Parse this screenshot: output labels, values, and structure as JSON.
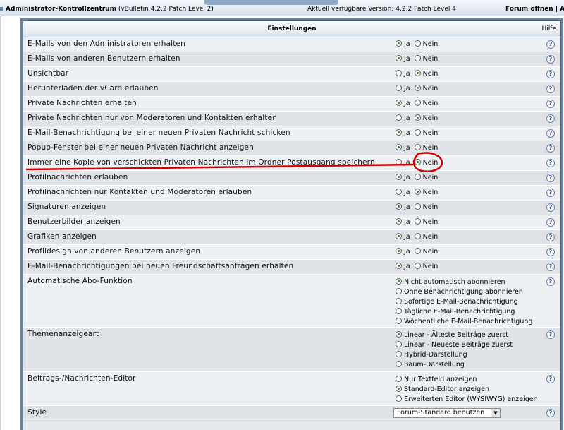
{
  "topbar": {
    "admin_title": "Administrator-Kontrollzentrum",
    "vb_version": "(vBulletin 4.2.2 Patch Level 2)",
    "available_version": "Aktuell verfügbare Version: 4.2.2 Patch Level 4",
    "forum_open": "Forum öffnen | Ab"
  },
  "panel": {
    "title": "Einstellungen",
    "help": "Hilfe"
  },
  "rows": [
    {
      "label": "E-Mails von den Administratoren erhalten",
      "yes": "Ja",
      "no": "Nein",
      "selected": "Ja"
    },
    {
      "label": "E-Mails von anderen Benutzern erhalten",
      "yes": "Ja",
      "no": "Nein",
      "selected": "Ja"
    },
    {
      "label": "Unsichtbar",
      "yes": "Ja",
      "no": "Nein",
      "selected": "Nein"
    },
    {
      "label": "Herunterladen der vCard erlauben",
      "yes": "Ja",
      "no": "Nein",
      "selected": "Nein"
    },
    {
      "label": "Private Nachrichten erhalten",
      "yes": "Ja",
      "no": "Nein",
      "selected": "Ja"
    },
    {
      "label": "Private Nachrichten nur von Moderatoren und Kontakten erhalten",
      "yes": "Ja",
      "no": "Nein",
      "selected": "Nein"
    },
    {
      "label": "E-Mail-Benachrichtigung bei einer neuen Privaten Nachricht schicken",
      "yes": "Ja",
      "no": "Nein",
      "selected": "Ja"
    },
    {
      "label": "Popup-Fenster bei einer neuen Privaten Nachricht anzeigen",
      "yes": "Ja",
      "no": "Nein",
      "selected": "Ja"
    },
    {
      "label": "Immer eine Kopie von verschickten Privaten Nachrichten im Ordner Postausgang speichern",
      "yes": "Ja",
      "no": "Nein",
      "selected": "Nein"
    },
    {
      "label": "Profilnachrichten erlauben",
      "yes": "Ja",
      "no": "Nein",
      "selected": "Ja"
    },
    {
      "label": "Profilnachrichten nur Kontakten und Moderatoren erlauben",
      "yes": "Ja",
      "no": "Nein",
      "selected": "Nein"
    },
    {
      "label": "Signaturen anzeigen",
      "yes": "Ja",
      "no": "Nein",
      "selected": "Ja"
    },
    {
      "label": "Benutzerbilder anzeigen",
      "yes": "Ja",
      "no": "Nein",
      "selected": "Ja"
    },
    {
      "label": "Grafiken anzeigen",
      "yes": "Ja",
      "no": "Nein",
      "selected": "Ja"
    },
    {
      "label": "Profildesign von anderen Benutzern anzeigen",
      "yes": "Ja",
      "no": "Nein",
      "selected": "Ja"
    },
    {
      "label": "E-Mail-Benachrichtigungen bei neuen Freundschaftsanfragen erhalten",
      "yes": "Ja",
      "no": "Nein",
      "selected": "Ja"
    }
  ],
  "subscription": {
    "label": "Automatische Abo-Funktion",
    "options": [
      "Nicht automatisch abonnieren",
      "Ohne Benachrichtigung abonnieren",
      "Sofortige E-Mail-Benachrichtigung",
      "Tägliche E-Mail-Benachrichtigung",
      "Wöchentliche E-Mail-Benachrichtigung"
    ],
    "selected": 0
  },
  "thread_display": {
    "label": "Themenanzeigeart",
    "options": [
      "Linear - Älteste Beiträge zuerst",
      "Linear - Neueste Beiträge zuerst",
      "Hybrid-Darstellung",
      "Baum-Darstellung"
    ],
    "selected": 0
  },
  "editor": {
    "label": "Beitrags-/Nachrichten-Editor",
    "options": [
      "Nur Textfeld anzeigen",
      "Standard-Editor anzeigen",
      "Erweiterten Editor (WYSIWYG) anzeigen"
    ],
    "selected": 1
  },
  "style": {
    "label": "Style",
    "value": "Forum-Standard benutzen"
  },
  "icons": {
    "help": "help-question-icon",
    "dropdown": "chevron-down-icon"
  },
  "colors": {
    "panel_frame": "#6b84a3",
    "annotation_red": "#d10000",
    "radio_dot": "#2c7a2c"
  }
}
